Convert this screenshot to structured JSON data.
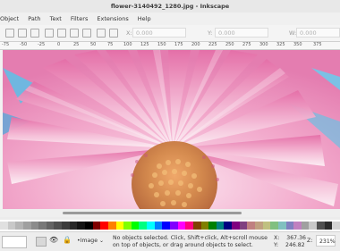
{
  "window": {
    "title": "flower-3140492_1280.jpg - Inkscape"
  },
  "menu": {
    "items": [
      "Object",
      "Path",
      "Text",
      "Filters",
      "Extensions",
      "Help"
    ]
  },
  "toolbar": {
    "x_label": "X:",
    "x_value": "0.000",
    "y_label": "Y:",
    "y_value": "0.000",
    "w_label": "W:",
    "w_value": "0.000"
  },
  "ruler": {
    "ticks": [
      "-75",
      "-50",
      "-25",
      "0",
      "25",
      "50",
      "75",
      "100",
      "125",
      "150",
      "175",
      "200",
      "225",
      "250",
      "275",
      "300",
      "325",
      "350",
      "375"
    ]
  },
  "statusbar": {
    "layer": "•Image",
    "message": "No objects selected. Click, Shift+click, Alt+scroll mouse on top of objects, or drag around objects to select.",
    "x_label": "X:",
    "x_value": "367.36",
    "y_label": "Y:",
    "y_value": "246.82",
    "zoom_label": "Z:",
    "zoom_value": "231%"
  },
  "palette": {
    "colors": [
      "#e0e0e0",
      "#c8c8c8",
      "#b4b4b4",
      "#a0a0a0",
      "#8c8c8c",
      "#787878",
      "#646464",
      "#505050",
      "#3c3c3c",
      "#282828",
      "#141414",
      "#000000",
      "#800000",
      "#ff0000",
      "#ff8000",
      "#ffff00",
      "#80ff00",
      "#00ff00",
      "#00ff80",
      "#00ffff",
      "#0080ff",
      "#0000ff",
      "#8000ff",
      "#ff00ff",
      "#ff0080",
      "#804000",
      "#808000",
      "#008000",
      "#008080",
      "#000080",
      "#800080",
      "#804080",
      "#c08080",
      "#c0a080",
      "#c0c080",
      "#80c080",
      "#80c0c0",
      "#8080c0",
      "#c080c0",
      "#a0a0a0",
      "#c8c8c8",
      "#505050",
      "#2c2c2c",
      "#d4d4d4"
    ]
  }
}
